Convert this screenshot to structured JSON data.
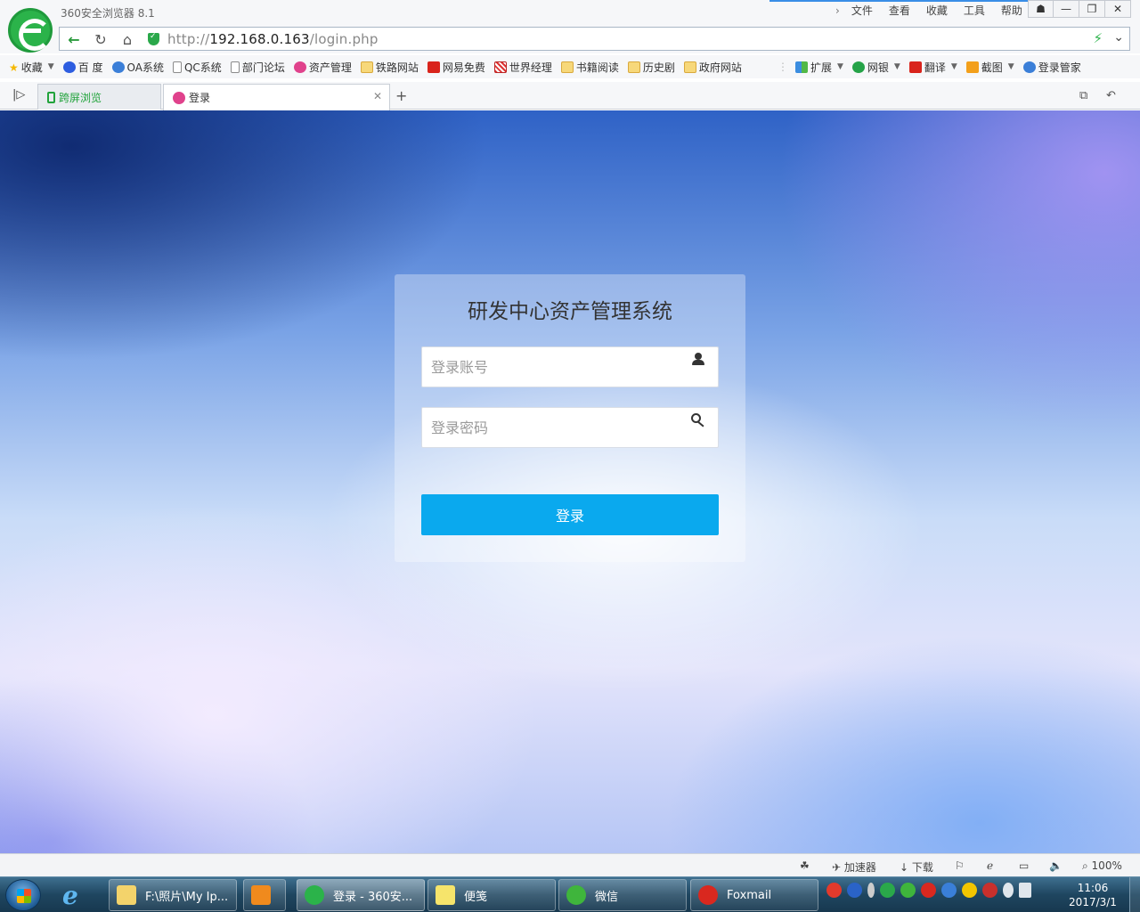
{
  "browser": {
    "app_title": "360安全浏览器 8.1",
    "menu": [
      "文件",
      "查看",
      "收藏",
      "工具",
      "帮助"
    ],
    "url_prefix": "http://",
    "url_host": "192.168.0.163",
    "url_path": "/login.php"
  },
  "bookmarks": [
    {
      "label": "收藏",
      "icon": "star-icon"
    },
    {
      "label": "百 度",
      "icon": "baidu-icon"
    },
    {
      "label": "OA系统",
      "icon": "oa-icon"
    },
    {
      "label": "QC系统",
      "icon": "page-icon"
    },
    {
      "label": "部门论坛",
      "icon": "page-icon"
    },
    {
      "label": "资产管理",
      "icon": "asset-icon"
    },
    {
      "label": "铁路网站",
      "icon": "folder-icon"
    },
    {
      "label": "网易免费",
      "icon": "netease-icon"
    },
    {
      "label": "世界经理",
      "icon": "manager-icon"
    },
    {
      "label": "书籍阅读",
      "icon": "folder-icon"
    },
    {
      "label": "历史剧",
      "icon": "folder-icon"
    },
    {
      "label": "政府网站",
      "icon": "folder-icon"
    }
  ],
  "toolbar_right": [
    {
      "label": "扩展",
      "icon": "extension-icon"
    },
    {
      "label": "网银",
      "icon": "bank-icon"
    },
    {
      "label": "翻译",
      "icon": "translate-icon"
    },
    {
      "label": "截图",
      "icon": "screenshot-icon"
    },
    {
      "label": "登录管家",
      "icon": "login-manager-icon"
    }
  ],
  "tabs": [
    {
      "label": "跨屏浏览"
    },
    {
      "label": "登录"
    }
  ],
  "login": {
    "title": "研发中心资产管理系统",
    "account_placeholder": "登录账号",
    "password_placeholder": "登录密码",
    "submit_label": "登录"
  },
  "statusbar": {
    "accelerator": "加速器",
    "download": "下载",
    "zoom": "100%"
  },
  "taskbar": {
    "tasks": [
      {
        "label": "F:\\照片\\My Ip...",
        "icon": "folder-icon",
        "color": "#f3d36b"
      },
      {
        "label": "",
        "icon": "media-player-icon",
        "color": "#f08a1d"
      },
      {
        "label": "登录 - 360安...",
        "icon": "browser-360-icon",
        "color": "#2bb34a"
      },
      {
        "label": "便笺",
        "icon": "sticky-notes-icon",
        "color": "#f6e46b"
      },
      {
        "label": "微信",
        "icon": "wechat-icon",
        "color": "#3fb53c"
      },
      {
        "label": "Foxmail",
        "icon": "foxmail-icon",
        "color": "#d9281f"
      }
    ],
    "time": "11:06",
    "date": "2017/3/1"
  },
  "colors": {
    "accent": "#0aa9ee",
    "browser_green": "#2bb34a"
  }
}
